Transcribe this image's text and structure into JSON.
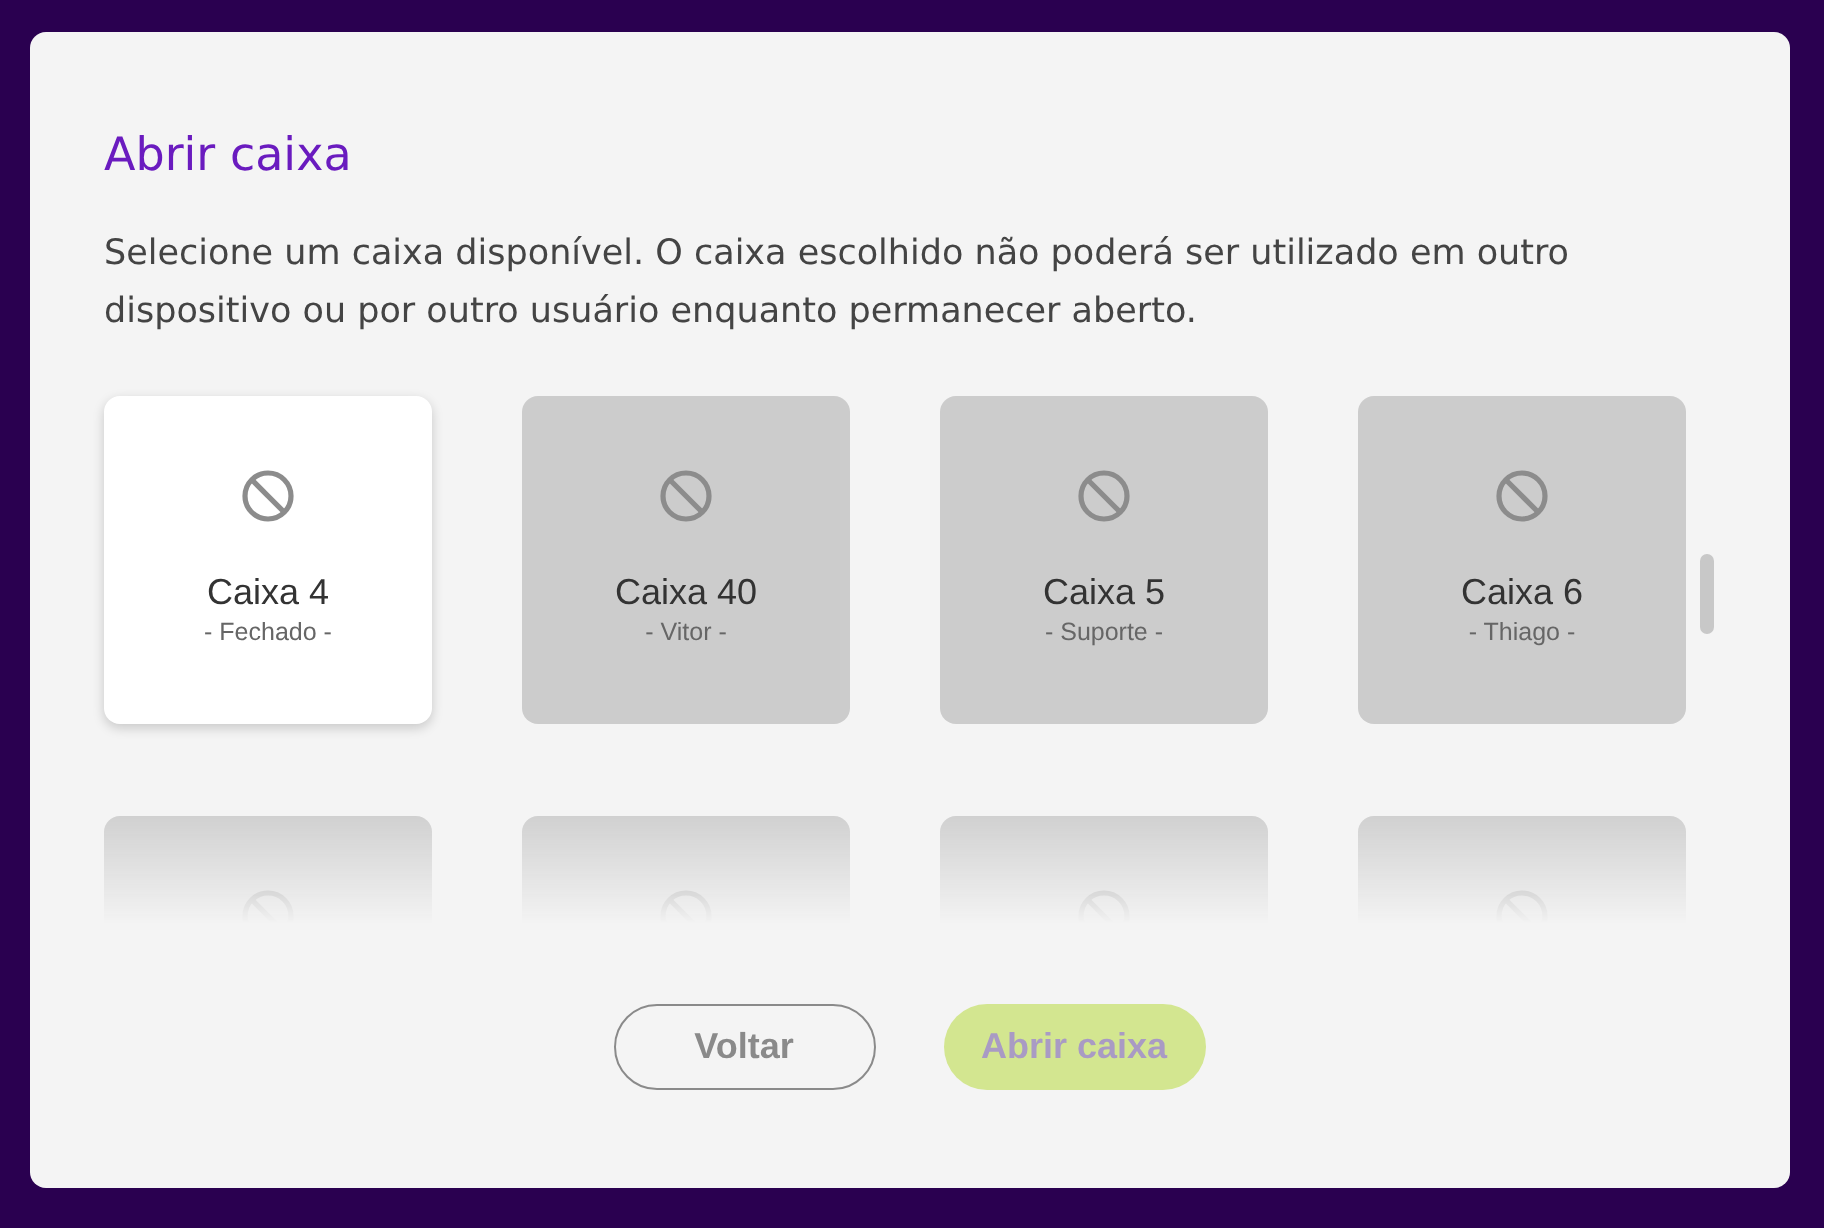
{
  "dialog": {
    "title": "Abrir caixa",
    "description": "Selecione um caixa disponível. O caixa escolhido não poderá ser utilizado em outro dispositivo ou por outro usuário enquanto permanecer aberto."
  },
  "registers": [
    {
      "name": "Caixa 4",
      "status": "- Fechado -",
      "disabled": false
    },
    {
      "name": "Caixa 40",
      "status": "- Vitor -",
      "disabled": true
    },
    {
      "name": "Caixa 5",
      "status": "- Suporte -",
      "disabled": true
    },
    {
      "name": "Caixa 6",
      "status": "- Thiago -",
      "disabled": true
    },
    {
      "disabled": true
    },
    {
      "disabled": true
    },
    {
      "disabled": true
    },
    {
      "disabled": true
    }
  ],
  "buttons": [
    {
      "label": "Voltar",
      "kind": "outline",
      "disabled": false
    },
    {
      "label": "Abrir caixa",
      "kind": "primary",
      "disabled": true
    }
  ]
}
